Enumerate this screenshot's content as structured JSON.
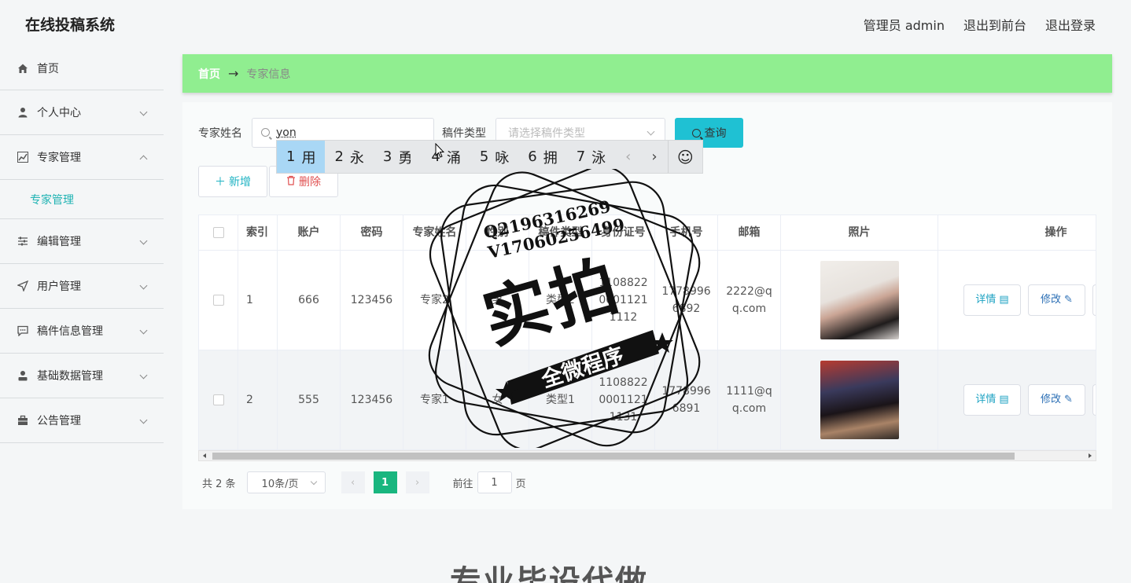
{
  "app": {
    "title": "在线投稿系统"
  },
  "top_links": {
    "admin": "管理员 admin",
    "front": "退出到前台",
    "logout": "退出登录"
  },
  "sidebar": {
    "items": [
      {
        "label": "首页",
        "icon": "home-icon"
      },
      {
        "label": "个人中心",
        "icon": "user-icon"
      },
      {
        "label": "专家管理",
        "icon": "chart-icon",
        "expanded": true,
        "sub": "专家管理"
      },
      {
        "label": "编辑管理",
        "icon": "sliders-icon"
      },
      {
        "label": "用户管理",
        "icon": "send-icon"
      },
      {
        "label": "稿件信息管理",
        "icon": "chat-icon"
      },
      {
        "label": "基础数据管理",
        "icon": "person-icon"
      },
      {
        "label": "公告管理",
        "icon": "briefcase-icon"
      }
    ]
  },
  "breadcrumb": {
    "home": "首页",
    "sep": "→",
    "current": "专家信息"
  },
  "search": {
    "name_label": "专家姓名",
    "name_value": "yon",
    "type_label": "稿件类型",
    "type_placeholder": "请选择稿件类型",
    "query_label": "查询"
  },
  "actions": {
    "add": "新增",
    "delete": "删除"
  },
  "table": {
    "columns": [
      "索引",
      "账户",
      "密码",
      "专家姓名",
      "性别",
      "稿件类型",
      "身份证号",
      "手机号",
      "邮箱",
      "照片",
      "操作"
    ],
    "rows": [
      {
        "index": "1",
        "account": "666",
        "password": "123456",
        "name": "专家2",
        "gender": "男",
        "type": "类型2",
        "id_card": "1108822 0001121 1112",
        "phone": "1778996 6892",
        "email": "2222@q q.com"
      },
      {
        "index": "2",
        "account": "555",
        "password": "123456",
        "name": "专家1",
        "gender": "女",
        "type": "类型1",
        "id_card": "1108822 0001121 1131",
        "phone": "1778996 6891",
        "email": "1111@q q.com"
      }
    ],
    "detail_label": "详情",
    "edit_label": "修改"
  },
  "pager": {
    "total": "共 2 条",
    "size": "10条/页",
    "page": "1",
    "goto": "前往",
    "goto_value": "1",
    "page_unit": "页"
  },
  "ime": {
    "candidates": [
      {
        "n": "1",
        "c": "用"
      },
      {
        "n": "2",
        "c": "永"
      },
      {
        "n": "3",
        "c": "勇"
      },
      {
        "n": "4",
        "c": "涌"
      },
      {
        "n": "5",
        "c": "咏"
      },
      {
        "n": "6",
        "c": "拥"
      },
      {
        "n": "7",
        "c": "泳"
      }
    ],
    "prev": "‹",
    "next": "›",
    "emoji": "☺"
  },
  "watermark": {
    "line1": "Q2196316269",
    "line2": "V17060256499",
    "big": "实拍",
    "ribbon": "全微程序"
  },
  "footer_text": "专业毕设代做"
}
